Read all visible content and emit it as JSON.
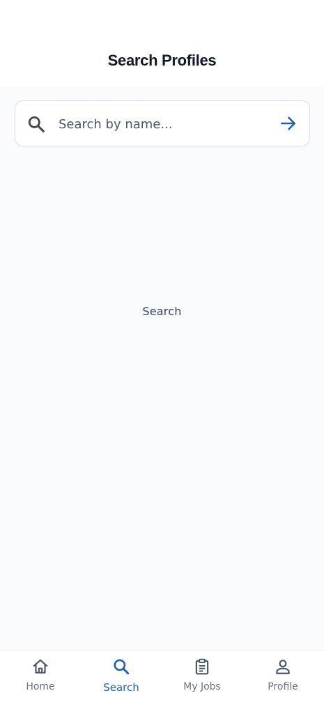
{
  "header": {
    "title": "Search Profiles"
  },
  "search": {
    "placeholder": "Search by name...",
    "value": ""
  },
  "main": {
    "empty_text": "Search"
  },
  "nav": {
    "items": [
      {
        "label": "Home",
        "icon": "home-icon",
        "active": false
      },
      {
        "label": "Search",
        "icon": "search-icon",
        "active": true
      },
      {
        "label": "My Jobs",
        "icon": "clipboard-icon",
        "active": false
      },
      {
        "label": "Profile",
        "icon": "person-icon",
        "active": false
      }
    ]
  },
  "colors": {
    "accent": "#1e5fae",
    "title": "#111827",
    "inactive": "#6b7280",
    "background": "#f8fafc"
  }
}
